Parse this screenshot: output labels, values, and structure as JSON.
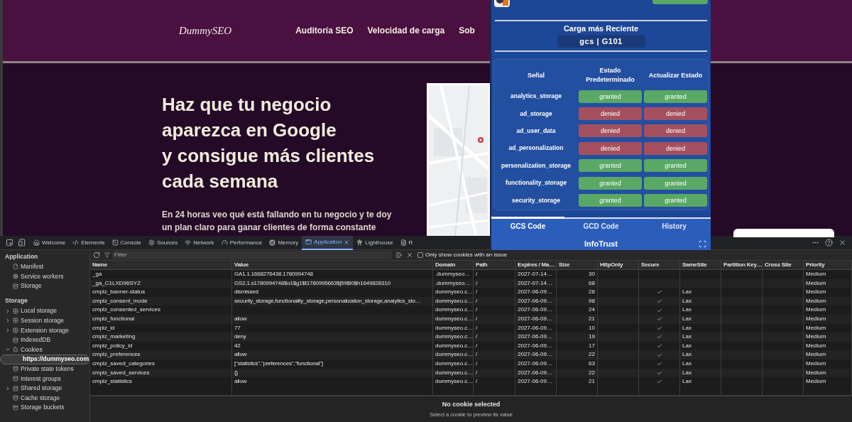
{
  "website": {
    "logo": "DummySEO",
    "nav": [
      "Auditoría SEO",
      "Velocidad de carga",
      "Sob"
    ],
    "headline": [
      "Haz que tu negocio",
      "aparezca en Google",
      "y consigue más clientes",
      "cada semana"
    ],
    "intro": "En 24 horas veo qué está fallando en tu negocio y te doy un plan claro para ganar clientes de forma constante"
  },
  "extension_popup": {
    "section_title": "Carga más Reciente",
    "latest_load": "gcs | G101",
    "columns": [
      "Señal",
      "Estado Predeterminado",
      "Actualizar Estado"
    ],
    "rows": [
      {
        "signal": "analytics_storage",
        "default": {
          "text": "granted",
          "color": "#5aa865"
        },
        "update": {
          "text": "granted",
          "color": "#5aa865"
        }
      },
      {
        "signal": "ad_storage",
        "default": {
          "text": "denied",
          "color": "#a4505f"
        },
        "update": {
          "text": "denied",
          "color": "#a4505f"
        }
      },
      {
        "signal": "ad_user_data",
        "default": {
          "text": "denied",
          "color": "#a4505f"
        },
        "update": {
          "text": "denied",
          "color": "#a4505f"
        }
      },
      {
        "signal": "ad_personalization",
        "default": {
          "text": "denied",
          "color": "#a4505f"
        },
        "update": {
          "text": "denied",
          "color": "#a4505f"
        }
      },
      {
        "signal": "personalization_storage",
        "default": {
          "text": "granted",
          "color": "#5aa865"
        },
        "update": {
          "text": "granted",
          "color": "#5aa865"
        }
      },
      {
        "signal": "functionality_storage",
        "default": {
          "text": "granted",
          "color": "#5aa865"
        },
        "update": {
          "text": "granted",
          "color": "#5aa865"
        }
      },
      {
        "signal": "security_storage",
        "default": {
          "text": "granted",
          "color": "#5aa865"
        },
        "update": {
          "text": "granted",
          "color": "#5aa865"
        }
      }
    ],
    "tabs": [
      {
        "label": "GCS Code",
        "selected": true
      },
      {
        "label": "GCD Code",
        "selected": false
      },
      {
        "label": "History",
        "selected": false
      }
    ],
    "footer": "InfoTrust"
  },
  "devtools": {
    "tabs": [
      {
        "label": "Welcome",
        "selected": false
      },
      {
        "label": "Elements",
        "selected": false
      },
      {
        "label": "Console",
        "selected": false
      },
      {
        "label": "Sources",
        "selected": false
      },
      {
        "label": "Network",
        "selected": false
      },
      {
        "label": "Performance",
        "selected": false
      },
      {
        "label": "Memory",
        "selected": false
      },
      {
        "label": "Application",
        "selected": true
      },
      {
        "label": "Lighthouse",
        "selected": false
      },
      {
        "label": "R",
        "selected": false
      }
    ],
    "filter": {
      "placeholder": "Filter"
    },
    "issue_filter": {
      "label": "Only show cookies with an issue",
      "checked": false
    },
    "sidebar": [
      {
        "heading": "Application",
        "items": [
          {
            "label": "Manifest",
            "selected": false
          },
          {
            "label": "Service workers",
            "selected": false
          },
          {
            "label": "Storage",
            "selected": false
          }
        ]
      },
      {
        "heading": "Storage",
        "items": [
          {
            "label": "Local storage",
            "selected": false,
            "expanded": false
          },
          {
            "label": "Session storage",
            "selected": false,
            "expanded": false
          },
          {
            "label": "Extension storage",
            "selected": false,
            "expanded": false
          },
          {
            "label": "IndexedDB",
            "selected": false
          },
          {
            "label": "Cookies",
            "selected": false,
            "expanded": true,
            "children": [
              {
                "label": "https://dummyseo.com",
                "selected": true
              }
            ]
          },
          {
            "label": "Private state tokens",
            "selected": false
          },
          {
            "label": "Interest groups",
            "selected": false
          },
          {
            "label": "Shared storage",
            "selected": false,
            "expanded": false
          },
          {
            "label": "Cache storage",
            "selected": false
          },
          {
            "label": "Storage buckets",
            "selected": false
          }
        ]
      }
    ],
    "cookies": {
      "columns": [
        "Name",
        "Value",
        "Domain",
        "Path",
        "Expires / Ma…",
        "Size",
        "HttpOnly",
        "Secure",
        "SameSite",
        "Partition Key…",
        "Cross Site",
        "Priority"
      ],
      "rows": [
        {
          "name": "_ga",
          "value": "GA1.1.1668276438.1780994748",
          "domain": ".dummyseo…",
          "path": "/",
          "expires": "2027-07-14…",
          "size": "30",
          "secure": false,
          "priority": "Medium"
        },
        {
          "name": "_ga_C1LXD96SYZ",
          "value": "GS2.1.s1780994748$o1$g1$t1780995663$j59$l0$h1649828310",
          "domain": ".dummyseo…",
          "path": "/",
          "expires": "2027-07-14…",
          "size": "68",
          "secure": false,
          "priority": "Medium"
        },
        {
          "name": "cmplz_banner-status",
          "value": "dismissed",
          "domain": "dummyseo.c…",
          "path": "/",
          "expires": "2027-06-09…",
          "size": "28",
          "secure": true,
          "same_site": "Lax",
          "priority": "Medium"
        },
        {
          "name": "cmplz_consent_mode",
          "value": "security_storage,functionality_storage,personalization_storage,analytics_sto…",
          "domain": "dummyseo.c…",
          "path": "/",
          "expires": "2027-06-09…",
          "size": "98",
          "secure": true,
          "same_site": "Lax",
          "priority": "Medium"
        },
        {
          "name": "cmplz_consented_services",
          "domain": "dummyseo.c…",
          "path": "/",
          "expires": "2027-06-09…",
          "size": "24",
          "secure": true,
          "same_site": "Lax",
          "priority": "Medium"
        },
        {
          "name": "cmplz_functional",
          "value": "allow",
          "domain": "dummyseo.c…",
          "path": "/",
          "expires": "2027-06-09…",
          "size": "21",
          "secure": true,
          "same_site": "Lax",
          "priority": "Medium"
        },
        {
          "name": "cmplz_id",
          "value": "77",
          "domain": "dummyseo.c…",
          "path": "/",
          "expires": "2027-06-09…",
          "size": "10",
          "secure": true,
          "same_site": "Lax",
          "priority": "Medium"
        },
        {
          "name": "cmplz_marketing",
          "value": "deny",
          "domain": "dummyseo.c…",
          "path": "/",
          "expires": "2027-06-09…",
          "size": "19",
          "secure": true,
          "same_site": "Lax",
          "priority": "Medium"
        },
        {
          "name": "cmplz_policy_id",
          "value": "42",
          "domain": "dummyseo.c…",
          "path": "/",
          "expires": "2027-06-09…",
          "size": "17",
          "secure": true,
          "same_site": "Lax",
          "priority": "Medium"
        },
        {
          "name": "cmplz_preferences",
          "value": "allow",
          "domain": "dummyseo.c…",
          "path": "/",
          "expires": "2027-06-09…",
          "size": "22",
          "secure": true,
          "same_site": "Lax",
          "priority": "Medium"
        },
        {
          "name": "cmplz_saved_categories",
          "value": "[\"statistics\",\"preferences\",\"functional\"]",
          "domain": "dummyseo.c…",
          "path": "/",
          "expires": "2027-06-09…",
          "size": "63",
          "secure": true,
          "same_site": "Lax",
          "priority": "Medium"
        },
        {
          "name": "cmplz_saved_services",
          "value": "{}",
          "domain": "dummyseo.c…",
          "path": "/",
          "expires": "2027-06-09…",
          "size": "22",
          "secure": true,
          "same_site": "Lax",
          "priority": "Medium"
        },
        {
          "name": "cmplz_statistics",
          "value": "allow",
          "domain": "dummyseo.c…",
          "path": "/",
          "expires": "2027-06-09…",
          "size": "21",
          "secure": true,
          "same_site": "Lax",
          "priority": "Medium"
        }
      ]
    },
    "preview": {
      "title": "No cookie selected",
      "hint": "Select a cookie to preview its value"
    }
  }
}
